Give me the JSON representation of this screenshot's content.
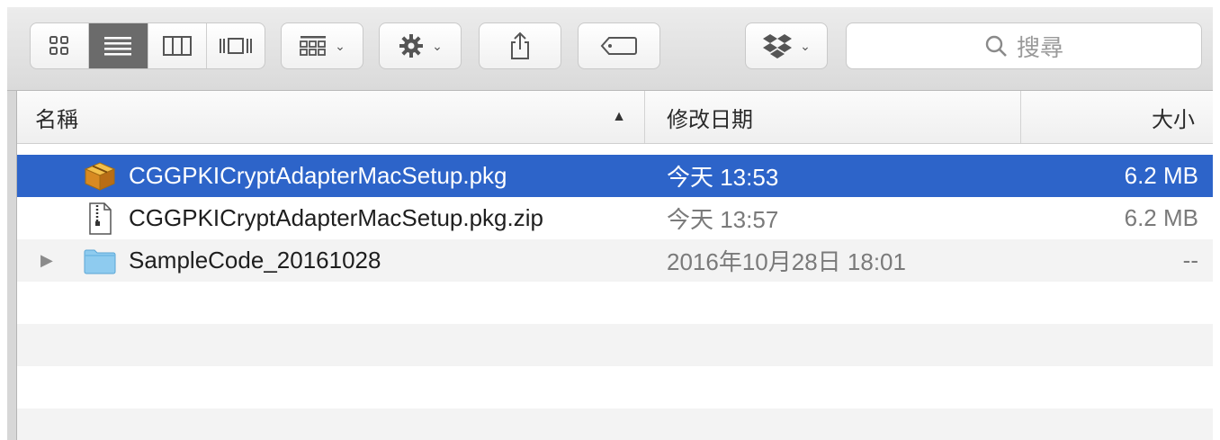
{
  "toolbar": {
    "view_modes": [
      {
        "name": "icon-view",
        "icon": "grid-icon"
      },
      {
        "name": "list-view",
        "icon": "list-icon",
        "active": true
      },
      {
        "name": "column-view",
        "icon": "columns-icon"
      },
      {
        "name": "cover-flow-view",
        "icon": "coverflow-icon"
      }
    ],
    "arrange_icon": "arrange-grid-icon",
    "action_icon": "gear-icon",
    "share_icon": "share-icon",
    "tag_icon": "tag-icon",
    "dropbox_icon": "dropbox-icon",
    "search_placeholder": "搜尋"
  },
  "columns": {
    "name": "名稱",
    "date": "修改日期",
    "size": "大小"
  },
  "files": [
    {
      "name": "CGGPKICryptAdapterMacSetup.pkg",
      "date": "今天 13:53",
      "size": "6.2 MB",
      "icon": "package-icon",
      "selected": true
    },
    {
      "name": "CGGPKICryptAdapterMacSetup.pkg.zip",
      "date": "今天 13:57",
      "size": "6.2 MB",
      "icon": "zip-file-icon",
      "selected": false
    },
    {
      "name": "SampleCode_20161028",
      "date": "2016年10月28日 18:01",
      "size": "--",
      "icon": "folder-icon",
      "selected": false,
      "expandable": true
    }
  ],
  "colors": {
    "selection": "#2d64c9",
    "stripe": "#f3f3f3",
    "folder": "#8ecbef"
  }
}
